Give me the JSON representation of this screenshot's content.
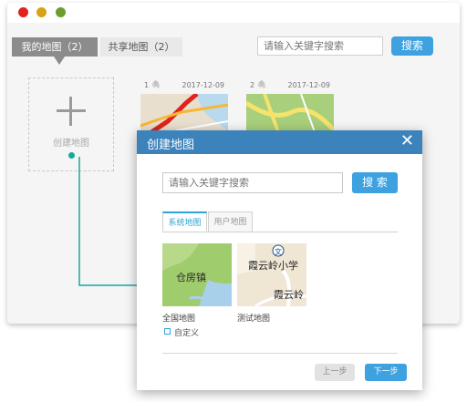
{
  "window": {
    "tabs": [
      {
        "label": "我的地图（2）",
        "active": true
      },
      {
        "label": "共享地图（2）",
        "active": false
      }
    ],
    "search": {
      "placeholder": "请输入关键字搜索",
      "button": "搜索"
    },
    "create_card": {
      "label": "创建地图"
    },
    "maps": [
      {
        "index": "1",
        "date": "2017-12-09"
      },
      {
        "index": "2",
        "date": "2017-12-09"
      }
    ]
  },
  "dialog": {
    "title": "创建地图",
    "close_icon": "close-icon",
    "search": {
      "placeholder": "请输入关键字搜索",
      "button": "搜 索"
    },
    "subtabs": [
      {
        "label": "系统地图",
        "active": true
      },
      {
        "label": "用户地图",
        "active": false
      }
    ],
    "templates": [
      {
        "label": "全国地图",
        "map_text": "仓房镇"
      },
      {
        "label": "测试地图",
        "map_text_1": "霞云岭小学",
        "map_text_2": "霞云岭",
        "marker": "文"
      }
    ],
    "checkbox": {
      "label": "自定义",
      "checked": false
    },
    "buttons": {
      "prev": "上一步",
      "next": "下一步"
    }
  },
  "colors": {
    "accent": "#3ea1e0",
    "dialog_header": "#3d83bb",
    "connector": "#18a8a0",
    "active_tab": "#8c8c8c"
  }
}
